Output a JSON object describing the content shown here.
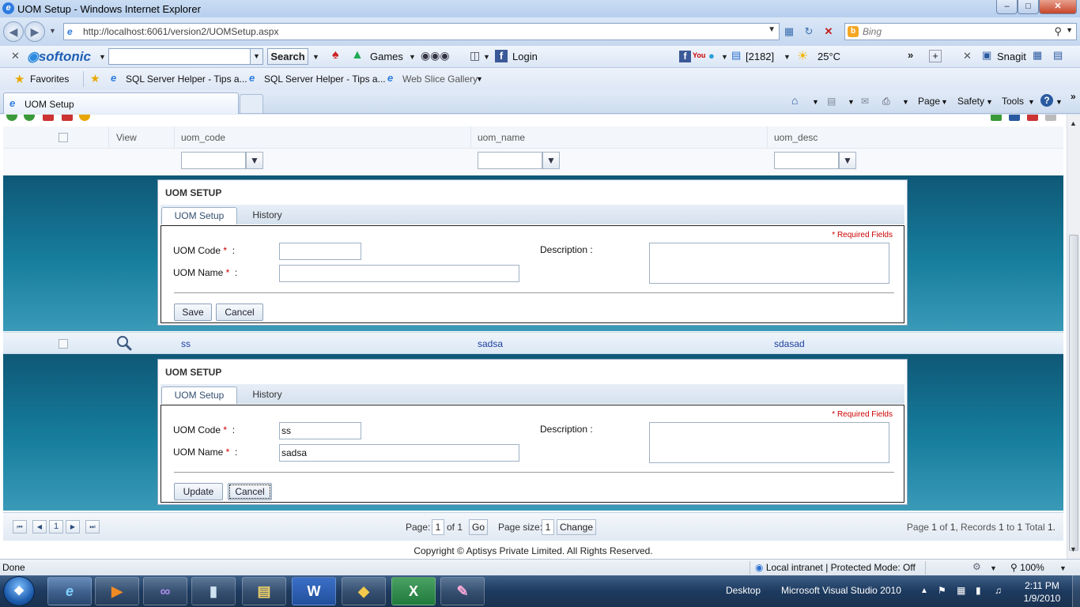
{
  "window": {
    "title": "UOM Setup - Windows Internet Explorer",
    "min_label": "–",
    "max_label": "□",
    "close_label": "✕"
  },
  "address": {
    "url": "http://localhost:6061/version2/UOMSetup.aspx",
    "search_placeholder": "Bing"
  },
  "softonic": {
    "brand": "softonic",
    "search_label": "Search",
    "games_label": "Games",
    "login_label": "Login",
    "count_label": "[2182]",
    "weather_label": "25°C",
    "snagit_label": "Snagit"
  },
  "favorites": {
    "favorites_label": "Favorites",
    "links": [
      "SQL Server Helper - Tips a...",
      "SQL Server Helper - Tips a...",
      "Web Slice Gallery"
    ]
  },
  "tabs": {
    "active_tab": "UOM Setup"
  },
  "commandbar": {
    "page": "Page",
    "safety": "Safety",
    "tools": "Tools"
  },
  "grid": {
    "columns": {
      "view": "View",
      "code": "uom_code",
      "name": "uom_name",
      "desc": "uom_desc"
    },
    "row": {
      "code": "ss",
      "name": "sadsa",
      "desc": "sdasad"
    }
  },
  "panel_new": {
    "title": "UOM SETUP",
    "tab_setup": "UOM Setup",
    "tab_history": "History",
    "required": "* Required Fields",
    "code_label": "UOM Code",
    "name_label": "UOM Name",
    "desc_label": "Description :",
    "code_value": "",
    "name_value": "",
    "save_label": "Save",
    "cancel_label": "Cancel"
  },
  "panel_edit": {
    "title": "UOM SETUP",
    "tab_setup": "UOM Setup",
    "tab_history": "History",
    "required": "* Required Fields",
    "code_label": "UOM Code",
    "name_label": "UOM Name",
    "desc_label": "Description :",
    "code_value": "ss",
    "name_value": "sadsa",
    "update_label": "Update",
    "cancel_label": "Cancel"
  },
  "pager": {
    "current_page": "1",
    "page_label": "Page:",
    "page_value": "1",
    "of_label": "of 1",
    "go_label": "Go",
    "pagesize_label": "Page size:",
    "pagesize_value": "1",
    "change_label": "Change",
    "summary_prefix": "Page",
    "summary_page": "1",
    "summary_of": "of",
    "summary_pages": "1",
    "summary_records": ", Records",
    "summary_from": "1",
    "summary_to": "to",
    "summary_to_val": "1",
    "summary_total": "Total",
    "summary_total_val": "1."
  },
  "footer": {
    "copyright": "Copyright © Aptisys Private Limited. All Rights Reserved."
  },
  "statusbar": {
    "status": "Done",
    "zone": "Local intranet | Protected Mode: Off",
    "zoom": "100%"
  },
  "taskbar": {
    "desktop_label": "Desktop",
    "vs_label": "Microsoft Visual Studio 2010",
    "time": "2:11 PM",
    "date": "1/9/2010"
  }
}
